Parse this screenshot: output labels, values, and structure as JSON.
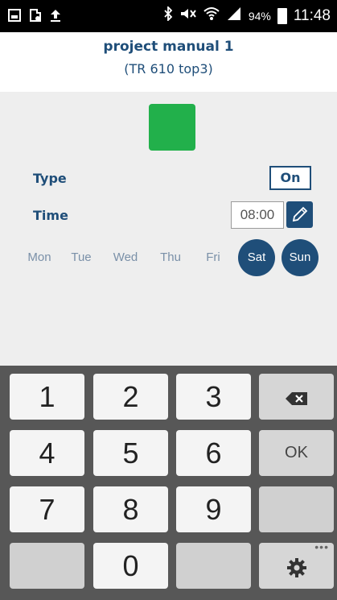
{
  "status_bar": {
    "battery_percent": "94%",
    "time": "11:48",
    "icons": [
      "gallery-icon",
      "clipboard-icon",
      "upload-icon",
      "bluetooth-icon",
      "mute-icon",
      "wifi-icon",
      "signal-icon",
      "battery-icon"
    ]
  },
  "header": {
    "title": "project manual 1",
    "subtitle": "(TR 610 top3)"
  },
  "settings": {
    "color_indicator": "#22b04b",
    "type_label": "Type",
    "type_value": "On",
    "time_label": "Time",
    "time_value": "08:00"
  },
  "days": [
    {
      "label": "Mon",
      "active": false
    },
    {
      "label": "Tue",
      "active": false
    },
    {
      "label": "Wed",
      "active": false
    },
    {
      "label": "Thu",
      "active": false
    },
    {
      "label": "Fri",
      "active": false
    },
    {
      "label": "Sat",
      "active": true
    },
    {
      "label": "Sun",
      "active": true
    }
  ],
  "keypad": {
    "keys": [
      "1",
      "2",
      "3",
      "4",
      "5",
      "6",
      "7",
      "8",
      "9",
      "0"
    ],
    "ok_label": "OK",
    "icons": [
      "backspace-icon",
      "settings-gear-icon"
    ]
  },
  "colors": {
    "accent": "#1f4e79",
    "indicator_green": "#22b04b",
    "keypad_bg": "#575757"
  }
}
